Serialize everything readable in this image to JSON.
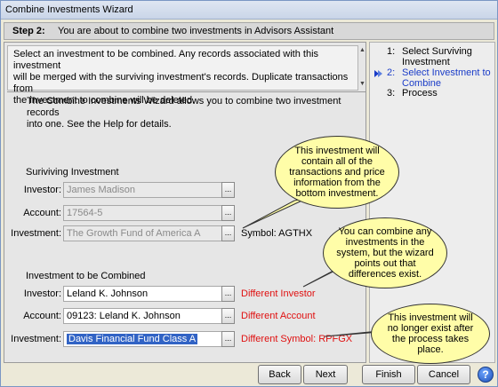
{
  "window": {
    "title": "Combine Investments Wizard"
  },
  "header": {
    "step_label": "Step 2:",
    "step_text": "You are about to combine two investments in Advisors Assistant"
  },
  "description": {
    "line1": "Select an investment to be combined.  Any records associated with this investment",
    "line2": "will be merged with the surviving investment's records.  Duplicate transactions from",
    "line3": "the investment to combine will be deleted."
  },
  "intro": {
    "line1": "The Combine Investments Wizard allows you to combine two investment records",
    "line2": "into one.  See the Help for details."
  },
  "steps": [
    {
      "num": "1:",
      "line1": "Select Surviving",
      "line2": "Investment"
    },
    {
      "num": "2:",
      "line1": "Select Investment to",
      "line2": "Combine"
    },
    {
      "num": "3:",
      "line1": "Process",
      "line2": ""
    }
  ],
  "surviving": {
    "section_label": "Suriviving Investment",
    "investor_label": "Investor:",
    "investor_value": "James Madison",
    "account_label": "Account:",
    "account_value": "17564-5",
    "investment_label": "Investment:",
    "investment_value": "The Growth Fund of America A",
    "symbol": "Symbol: AGTHX"
  },
  "combine": {
    "section_label": "Investment to be Combined",
    "investor_label": "Investor:",
    "investor_value": "Leland K. Johnson",
    "investor_warning": "Different Investor",
    "account_label": "Account:",
    "account_value": "09123: Leland K. Johnson",
    "account_warning": "Different Account",
    "investment_label": "Investment:",
    "investment_value": "Davis Financial Fund Class A",
    "investment_warning": "Different Symbol: RPFGX"
  },
  "browse_label": "...",
  "callouts": {
    "c1": [
      "This investment will",
      "contain all of the",
      "transactions and price",
      "information from the",
      "bottom investment."
    ],
    "c2": [
      "You can combine any",
      "investments in the",
      "system, but the wizard",
      "points out that",
      "differences exist."
    ],
    "c3": [
      "This investment will",
      "no longer exist after",
      "the process takes",
      "place."
    ]
  },
  "buttons": {
    "back": "Back",
    "next": "Next",
    "finish": "Finish",
    "cancel": "Cancel",
    "help": "?"
  },
  "colors": {
    "warning": "#e01010",
    "callout_fill": "#fffda8",
    "active_step": "#1a3cc8",
    "selection": "#3163c5"
  }
}
